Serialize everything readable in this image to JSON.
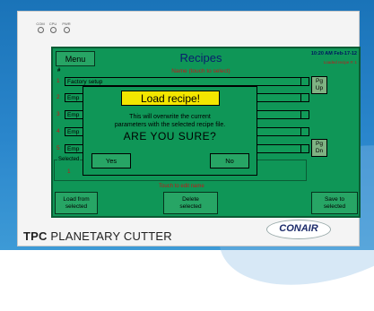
{
  "leds": [
    "COM",
    "CPU",
    "PWR"
  ],
  "header": {
    "menu_label": "Menu",
    "title": "Recipes",
    "clock": "10:20 AM Feb-17-12",
    "loaded_recipe": "Loaded recipe #:   1"
  },
  "table": {
    "hash_label": "#",
    "name_header": "Name (touch to select)",
    "rows": [
      {
        "num": "1",
        "name": "Factory setup"
      },
      {
        "num": "2",
        "name": "Emp"
      },
      {
        "num": "3",
        "name": "Emp"
      },
      {
        "num": "4",
        "name": "Emp"
      },
      {
        "num": "5",
        "name": "Emp"
      }
    ]
  },
  "paging": {
    "up_line1": "Pg",
    "up_line2": "Up",
    "down_line1": "Pg",
    "down_line2": "Dn"
  },
  "selected": {
    "legend": "Selected",
    "num": "1"
  },
  "touch_edit": "Touch to edit name",
  "bottom_buttons": {
    "load_l1": "Load from",
    "load_l2": "selected",
    "delete_l1": "Delete",
    "delete_l2": "selected",
    "save_l1": "Save to",
    "save_l2": "selected"
  },
  "dialog": {
    "title": "Load recipe!",
    "msg_line1": "This will overwrite the current",
    "msg_line2": "parameters with the selected recipe file.",
    "are_you_sure": "ARE YOU SURE?",
    "yes": "Yes",
    "no": "No"
  },
  "branding": {
    "product_bold": "TPC",
    "product_rest": " PLANETARY CUTTER",
    "logo": "CONAIR"
  },
  "colors": {
    "screen": "#0f9657",
    "button": "#27a565",
    "dialog_title": "#f3e600",
    "accent_red": "#c2181c",
    "title_blue": "#0a1d6e",
    "background_blue": "#1a73b8"
  }
}
